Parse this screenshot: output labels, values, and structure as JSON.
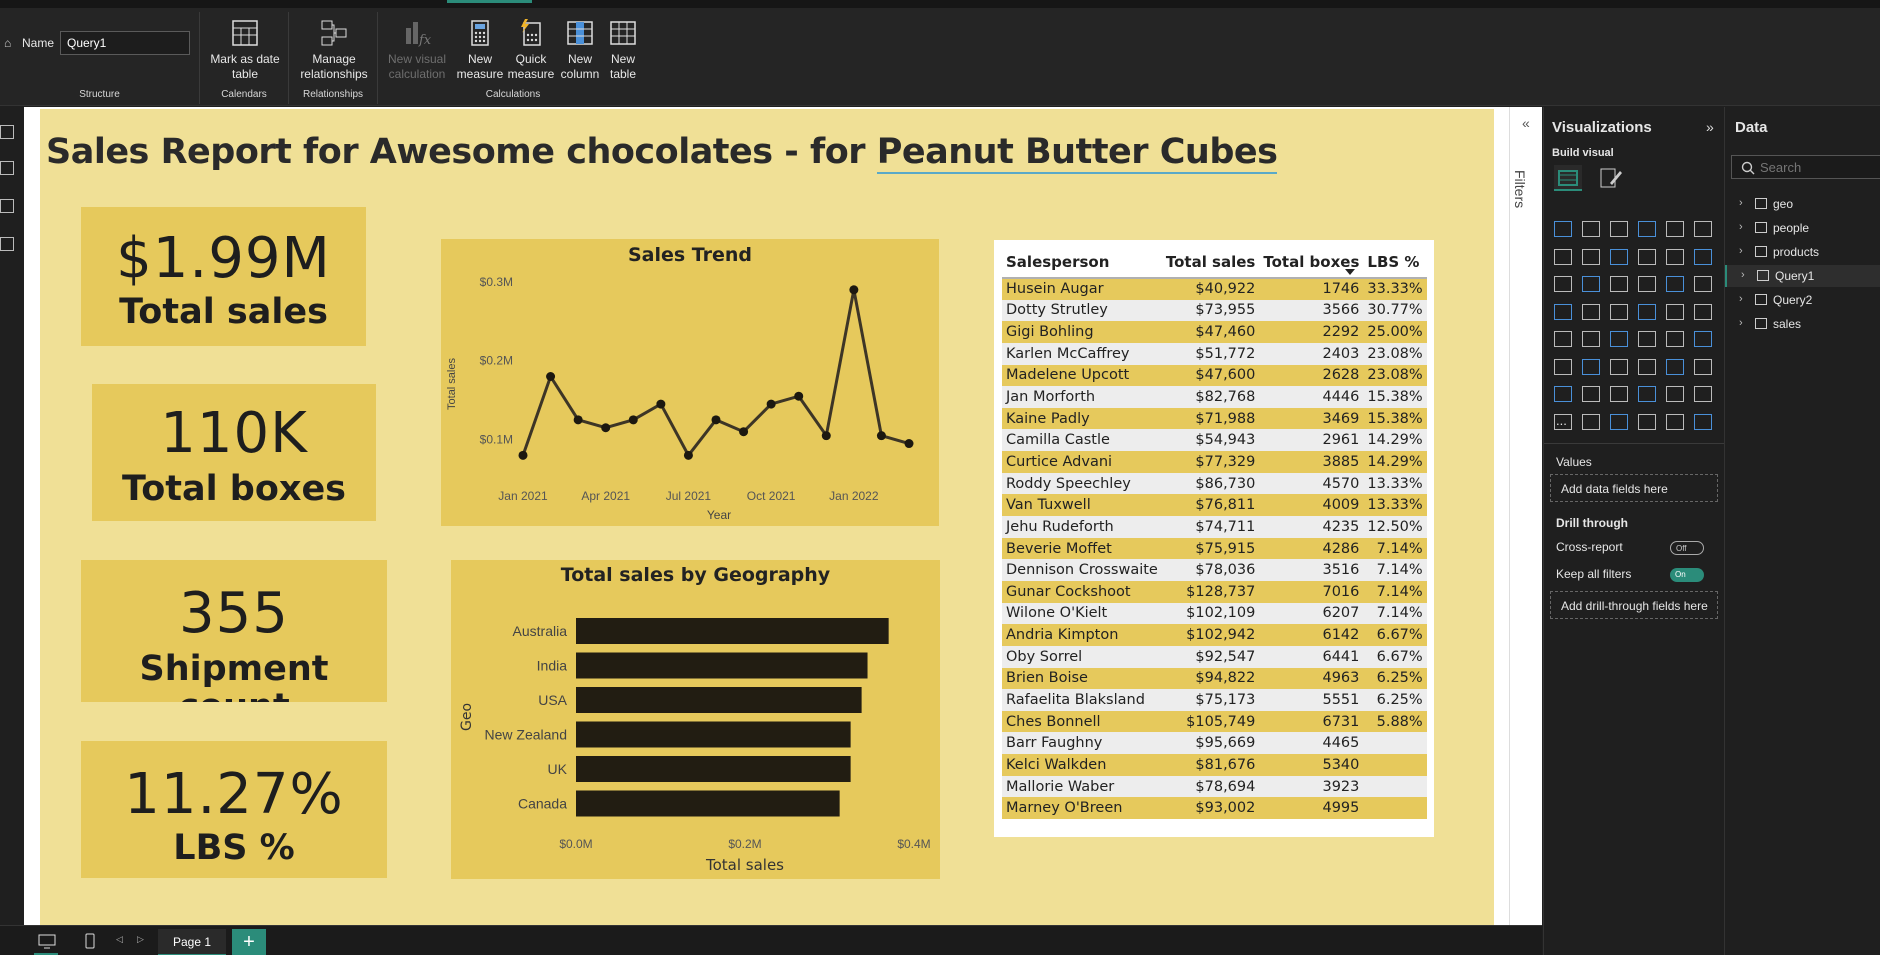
{
  "ribbon": {
    "name_label": "Name",
    "name_value": "Query1",
    "groups": {
      "structure": "Structure",
      "calendars": "Calendars",
      "relationships": "Relationships",
      "calculations": "Calculations"
    },
    "buttons": {
      "mark_date_1": "Mark as date",
      "mark_date_2": "table",
      "manage_rel_1": "Manage",
      "manage_rel_2": "relationships",
      "new_visual_calc_1": "New visual",
      "new_visual_calc_2": "calculation",
      "new_measure_1": "New",
      "new_measure_2": "measure",
      "quick_measure_1": "Quick",
      "quick_measure_2": "measure",
      "new_column_1": "New",
      "new_column_2": "column",
      "new_table_1": "New",
      "new_table_2": "table"
    }
  },
  "report": {
    "title_prefix": "Sales Report for Awesome chocolates - for ",
    "title_product": "Peanut Butter Cubes"
  },
  "cards": [
    {
      "value": "$1.99M",
      "label": "Total sales"
    },
    {
      "value": "110K",
      "label": "Total boxes"
    },
    {
      "value": "355",
      "label": "Shipment count"
    },
    {
      "value": "11.27%",
      "label": "LBS %"
    }
  ],
  "chart_data": [
    {
      "type": "line",
      "title": "Sales Trend",
      "xlabel": "Year",
      "ylabel": "Total sales",
      "x_ticks": [
        "Jan 2021",
        "Apr 2021",
        "Jul 2021",
        "Oct 2021",
        "Jan 2022"
      ],
      "y_ticks": [
        "$0.1M",
        "$0.2M",
        "$0.3M"
      ],
      "ylim": [
        0.05,
        0.31
      ],
      "x": [
        "2021-01",
        "2021-02",
        "2021-03",
        "2021-04",
        "2021-05",
        "2021-06",
        "2021-07",
        "2021-08",
        "2021-09",
        "2021-10",
        "2021-11",
        "2021-12",
        "2022-01",
        "2022-02",
        "2022-03"
      ],
      "values": [
        0.08,
        0.18,
        0.125,
        0.115,
        0.125,
        0.145,
        0.08,
        0.125,
        0.11,
        0.145,
        0.155,
        0.105,
        0.29,
        0.105,
        0.095
      ],
      "color": "#3d3526",
      "grid": false
    },
    {
      "type": "bar",
      "orientation": "horizontal",
      "title": "Total sales by Geography",
      "xlabel": "Total sales",
      "ylabel": "Geo",
      "categories": [
        "Australia",
        "India",
        "USA",
        "New Zealand",
        "UK",
        "Canada"
      ],
      "values": [
        0.37,
        0.345,
        0.338,
        0.325,
        0.325,
        0.312
      ],
      "xlim": [
        0,
        0.4
      ],
      "x_ticks": [
        "$0.0M",
        "$0.2M",
        "$0.4M"
      ],
      "color": "#221d12",
      "grid": false
    },
    {
      "type": "table",
      "columns": [
        "Salesperson",
        "Total sales",
        "Total boxes",
        "LBS %"
      ],
      "sorted_by": "LBS %",
      "rows": [
        [
          "Husein Augar",
          "$40,922",
          "1746",
          "33.33%"
        ],
        [
          "Dotty Strutley",
          "$73,955",
          "3566",
          "30.77%"
        ],
        [
          "Gigi Bohling",
          "$47,460",
          "2292",
          "25.00%"
        ],
        [
          "Karlen McCaffrey",
          "$51,772",
          "2403",
          "23.08%"
        ],
        [
          "Madelene Upcott",
          "$47,600",
          "2628",
          "23.08%"
        ],
        [
          "Jan Morforth",
          "$82,768",
          "4446",
          "15.38%"
        ],
        [
          "Kaine Padly",
          "$71,988",
          "3469",
          "15.38%"
        ],
        [
          "Camilla Castle",
          "$54,943",
          "2961",
          "14.29%"
        ],
        [
          "Curtice Advani",
          "$77,329",
          "3885",
          "14.29%"
        ],
        [
          "Roddy Speechley",
          "$86,730",
          "4570",
          "13.33%"
        ],
        [
          "Van Tuxwell",
          "$76,811",
          "4009",
          "13.33%"
        ],
        [
          "Jehu Rudeforth",
          "$74,711",
          "4235",
          "12.50%"
        ],
        [
          "Beverie Moffet",
          "$75,915",
          "4286",
          "7.14%"
        ],
        [
          "Dennison Crosswaite",
          "$78,036",
          "3516",
          "7.14%"
        ],
        [
          "Gunar Cockshoot",
          "$128,737",
          "7016",
          "7.14%"
        ],
        [
          "Wilone O'Kielt",
          "$102,109",
          "6207",
          "7.14%"
        ],
        [
          "Andria Kimpton",
          "$102,942",
          "6142",
          "6.67%"
        ],
        [
          "Oby Sorrel",
          "$92,547",
          "6441",
          "6.67%"
        ],
        [
          "Brien Boise",
          "$94,822",
          "4963",
          "6.25%"
        ],
        [
          "Rafaelita Blaksland",
          "$75,173",
          "5551",
          "6.25%"
        ],
        [
          "Ches Bonnell",
          "$105,749",
          "6731",
          "5.88%"
        ],
        [
          "Barr Faughny",
          "$95,669",
          "4465",
          ""
        ],
        [
          "Kelci Walkden",
          "$81,676",
          "5340",
          ""
        ],
        [
          "Mallorie Waber",
          "$78,694",
          "3923",
          ""
        ],
        [
          "Marney O'Breen",
          "$93,002",
          "4995",
          ""
        ]
      ]
    }
  ],
  "filters": {
    "label": "Filters"
  },
  "viz_pane": {
    "title": "Visualizations",
    "build_visual": "Build visual",
    "more": "...",
    "values_label": "Values",
    "add_data_fields": "Add data fields here",
    "drill_through": "Drill through",
    "cross_report": "Cross-report",
    "cross_report_state": "Off",
    "keep_all_filters": "Keep all filters",
    "keep_all_filters_state": "On",
    "add_drill_fields": "Add drill-through fields here"
  },
  "data_pane": {
    "title": "Data",
    "search_placeholder": "Search",
    "tables": [
      "geo",
      "people",
      "products",
      "Query1",
      "Query2",
      "sales"
    ],
    "active_table": "Query1"
  },
  "bottom": {
    "page_tab": "Page 1",
    "add_page": "+"
  },
  "colors": {
    "canvas_bg": "#f0e096",
    "card_bg": "#e6c95c",
    "accent": "#2b8c7a"
  }
}
